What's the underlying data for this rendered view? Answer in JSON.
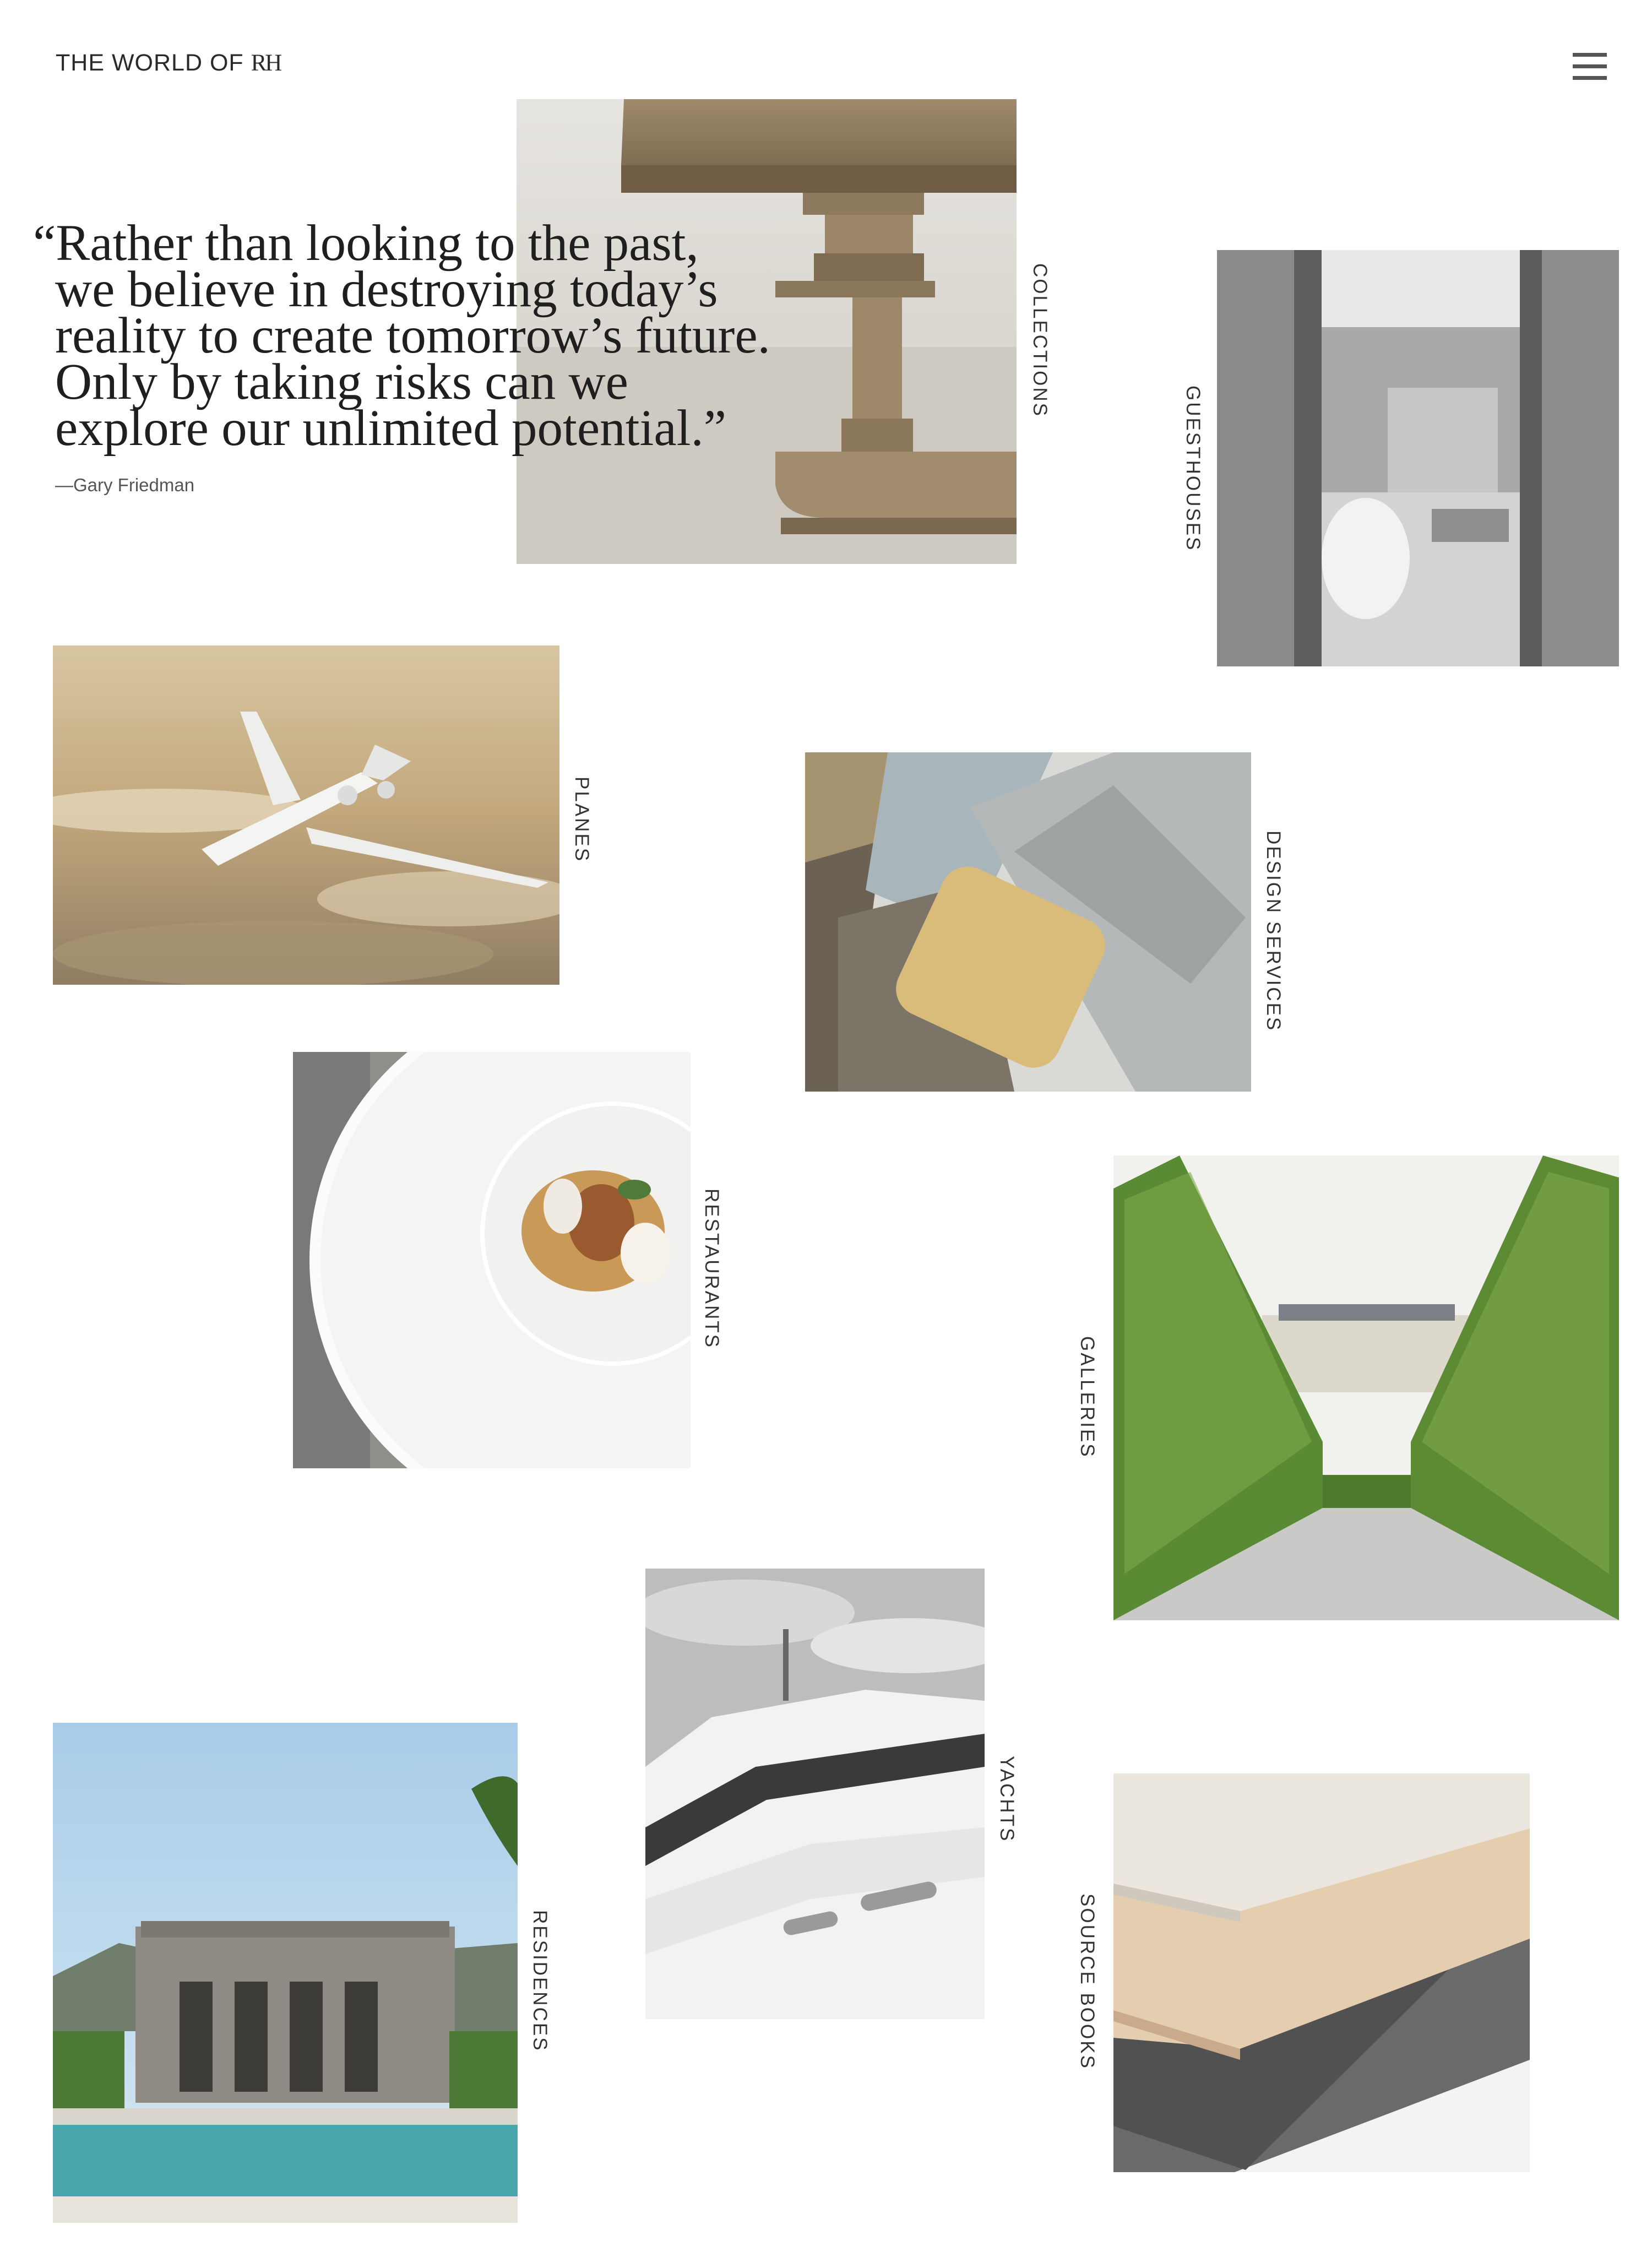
{
  "header": {
    "logo_text": "THE WORLD OF ",
    "logo_mark": "RH",
    "menu_icon": "hamburger-menu-icon"
  },
  "quote": {
    "lines": [
      "“Rather than looking to the past,",
      "we believe in destroying today’s",
      "reality to create tomorrow’s future.",
      "Only by taking risks can we",
      "explore our unlimited potential.”"
    ],
    "attribution": "—Gary Friedman"
  },
  "sections": [
    {
      "id": "collections",
      "label": "COLLECTIONS"
    },
    {
      "id": "guesthouses",
      "label": "GUESTHOUSES"
    },
    {
      "id": "planes",
      "label": "PLANES"
    },
    {
      "id": "design-services",
      "label": "DESIGN SERVICES"
    },
    {
      "id": "restaurants",
      "label": "RESTAURANTS"
    },
    {
      "id": "galleries",
      "label": "GALLERIES"
    },
    {
      "id": "yachts",
      "label": "YACHTS"
    },
    {
      "id": "residences",
      "label": "RESIDENCES"
    },
    {
      "id": "source-books",
      "label": "SOURCE BOOKS"
    }
  ]
}
